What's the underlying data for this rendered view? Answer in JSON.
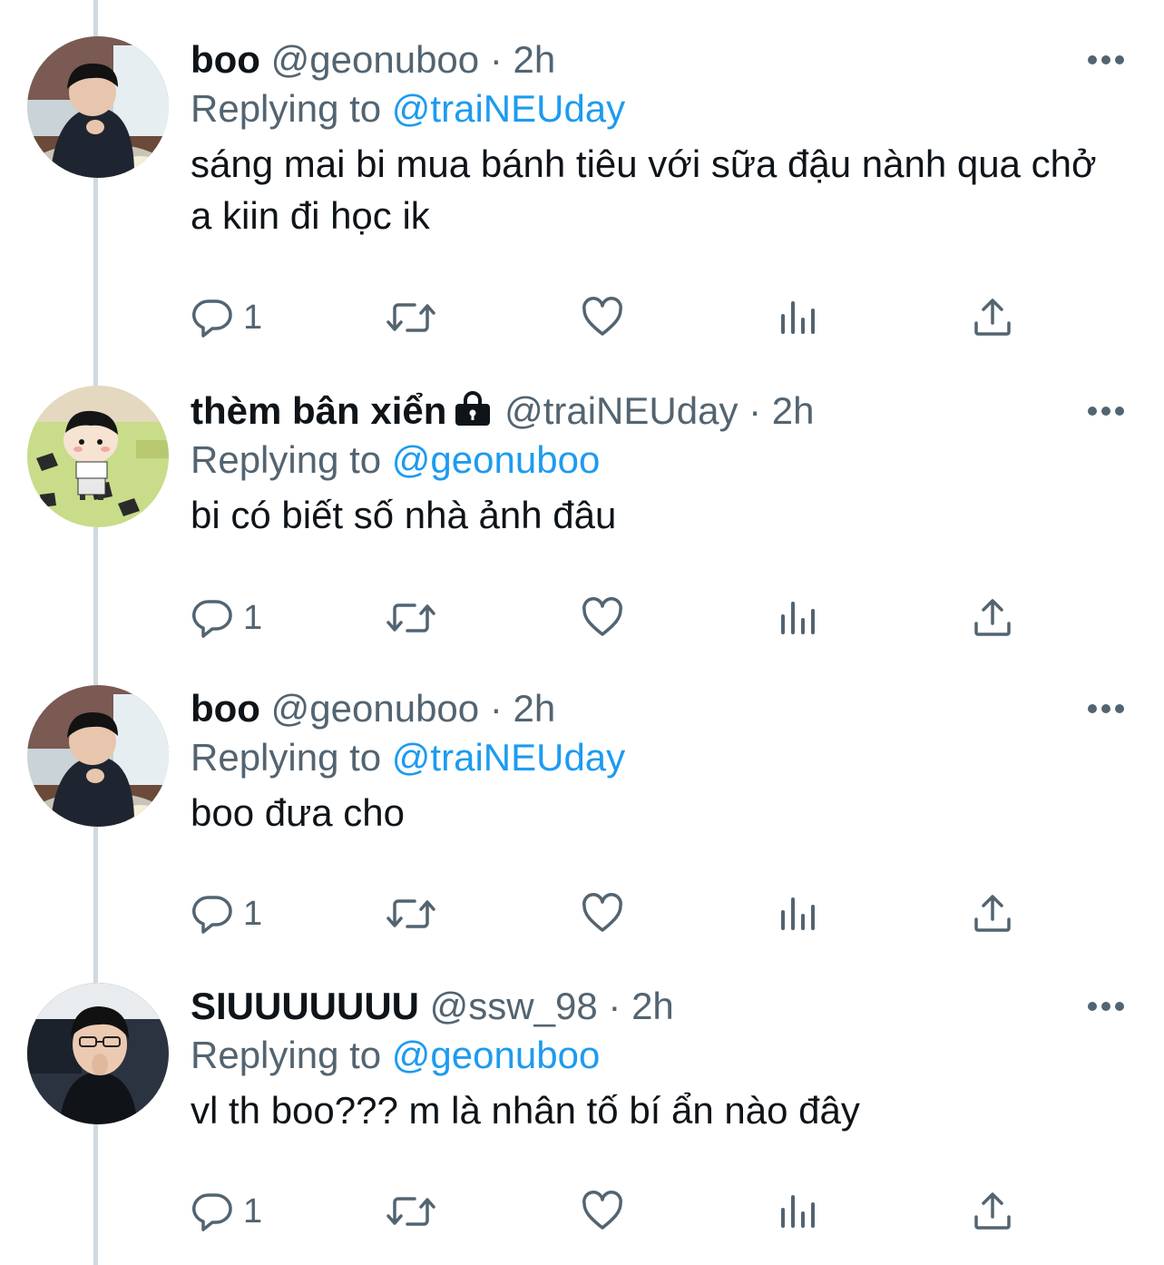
{
  "thread": {
    "tweets": [
      {
        "name": "boo",
        "handle": "@geonuboo",
        "separator": "·",
        "time": "2h",
        "replying_label": "Replying to",
        "replying_to": "@traiNEUday",
        "text": "sáng mai bi mua bánh tiêu với sữa đậu nành qua chở a kiin đi học ik",
        "protected": false,
        "reply_count": "1"
      },
      {
        "name": "thèm bân xiển",
        "handle": "@traiNEUday",
        "separator": "·",
        "time": "2h",
        "replying_label": "Replying to",
        "replying_to": "@geonuboo",
        "text": "bi có biết số nhà ảnh đâu",
        "protected": true,
        "reply_count": "1"
      },
      {
        "name": "boo",
        "handle": "@geonuboo",
        "separator": "·",
        "time": "2h",
        "replying_label": "Replying to",
        "replying_to": "@traiNEUday",
        "text": "boo đưa cho",
        "protected": false,
        "reply_count": "1"
      },
      {
        "name": "SIUUUUUUU",
        "handle": "@ssw_98",
        "separator": "·",
        "time": "2h",
        "replying_label": "Replying to",
        "replying_to": "@geonuboo",
        "text": "vl th boo??? m là nhân tố bí ẩn nào đây",
        "protected": false,
        "reply_count": "1"
      }
    ]
  },
  "icons": {
    "more": "more-horizontal-icon",
    "reply": "reply-bubble-icon",
    "retweet": "retweet-icon",
    "like": "heart-icon",
    "views": "views-bar-chart-icon",
    "share": "share-upload-icon",
    "lock": "lock-icon"
  },
  "colors": {
    "text_primary": "#0f1419",
    "text_secondary": "#536471",
    "link": "#1d9bf0",
    "thread_line": "#cfd9de"
  }
}
